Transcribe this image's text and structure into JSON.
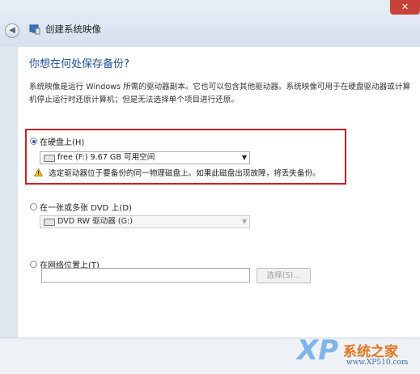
{
  "window": {
    "title": "创建系统映像",
    "close_glyph": "✕",
    "back_glyph": "◀"
  },
  "page": {
    "heading": "你想在何处保存备份?",
    "description": "系统映像是运行 Windows 所需的驱动器副本。它也可以包含其他驱动器。系统映像可用于在硬盘驱动器或计算机停止运行时还原计算机；但是无法选择单个项目进行还原。"
  },
  "options": {
    "hard_disk": {
      "label": "在硬盘上(H)",
      "selected_drive": "free (F:)  9.67 GB 可用空间",
      "warning": "选定驱动器位于要备份的同一物理磁盘上。如果此磁盘出现故障，将丢失备份。"
    },
    "dvd": {
      "label": "在一张或多张 DVD 上(D)",
      "selected_drive": "DVD RW 驱动器 (G:)"
    },
    "network": {
      "label": "在网络位置上(T)",
      "path_value": "",
      "select_button": "选择(S)..."
    }
  },
  "watermark": {
    "logo": "XP",
    "site_name": "系统之家",
    "url": "www.XP510.com"
  },
  "colors": {
    "highlight_border": "#cf1f24",
    "heading_blue": "#1f4f9a",
    "close_red": "#c8423a"
  }
}
